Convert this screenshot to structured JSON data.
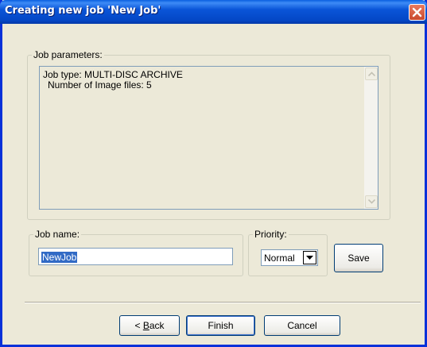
{
  "window": {
    "title": "Creating new job 'New Job'"
  },
  "job_parameters": {
    "legend": "Job parameters:",
    "lines": [
      "Job type: MULTI-DISC ARCHIVE",
      "Number of Image files: 5"
    ]
  },
  "job_name": {
    "legend": "Job name:",
    "value": "NewJob"
  },
  "priority": {
    "legend": "Priority:",
    "selected": "Normal"
  },
  "buttons": {
    "save": "Save",
    "back_prefix": "",
    "back_mnemonic": "B",
    "back_rest": "ack",
    "finish": "Finish",
    "cancel": "Cancel"
  },
  "colors": {
    "title_bar": "#0a55d8",
    "selection": "#316ac5",
    "dialog_face": "#ece9d8"
  }
}
